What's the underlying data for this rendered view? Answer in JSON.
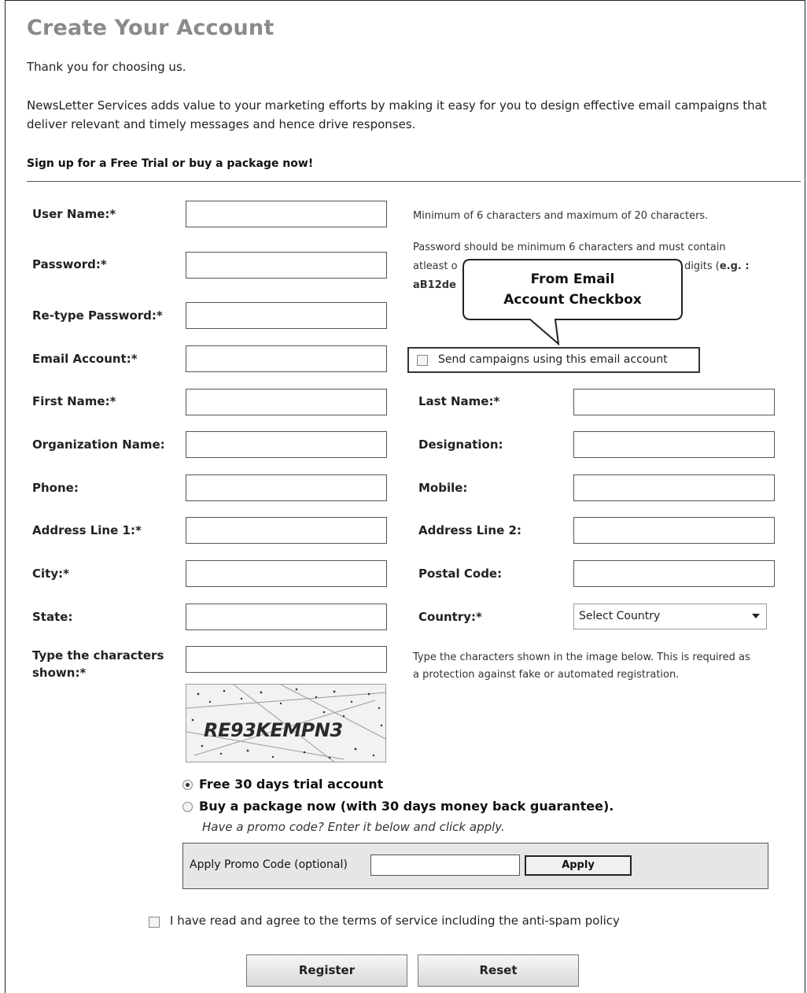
{
  "header": {
    "title": "Create Your Account",
    "thanks": "Thank you for choosing us.",
    "intro": "NewsLetter Services adds value to your marketing efforts by making it easy for you to design effective email campaigns that deliver relevant and timely messages and hence drive responses.",
    "signup_heading": "Sign up for a Free Trial or buy a package now!"
  },
  "form": {
    "labels": {
      "username": "User Name:*",
      "password": "Password:*",
      "retype_password": "Re-type Password:*",
      "email": "Email Account:*",
      "first_name": "First Name:*",
      "org_name": "Organization Name:",
      "phone": "Phone:",
      "address1": "Address Line 1:*",
      "city": "City:*",
      "state": "State:",
      "captcha": "Type the characters shown:*",
      "last_name": "Last Name:*",
      "designation": "Designation:",
      "mobile": "Mobile:",
      "address2": "Address Line 2:",
      "postal_code": "Postal Code:",
      "country": "Country:*"
    },
    "hints": {
      "username": "Minimum of 6 characters and maximum of 20 characters.",
      "password_line1": "Password should be minimum 6 characters and must contain",
      "password_line2_start": "atleast o",
      "password_line2_end": "digits (",
      "password_example_label": "e.g. :",
      "password_line3": "aB12de",
      "captcha": "Type the characters shown in the image below. This is required as a protection against fake or automated registration."
    },
    "send_campaigns_label": "Send campaigns using this email account",
    "send_campaigns_checked": false,
    "country_select": "Select Country",
    "captcha_text": "RE93KEMPN3"
  },
  "callout": {
    "text_line1": "From Email",
    "text_line2": "Account Checkbox"
  },
  "plan": {
    "free_label": "Free 30 days trial account",
    "buy_label": "Buy a package now (with 30 days money back guarantee).",
    "selected": "free",
    "promo_hint": "Have a promo code? Enter it below and click apply.",
    "promo_label": "Apply Promo Code (optional)",
    "apply_label": "Apply"
  },
  "terms": {
    "label": "I have read and agree to the terms of service including the anti-spam policy",
    "checked": false
  },
  "actions": {
    "register": "Register",
    "reset": "Reset"
  }
}
